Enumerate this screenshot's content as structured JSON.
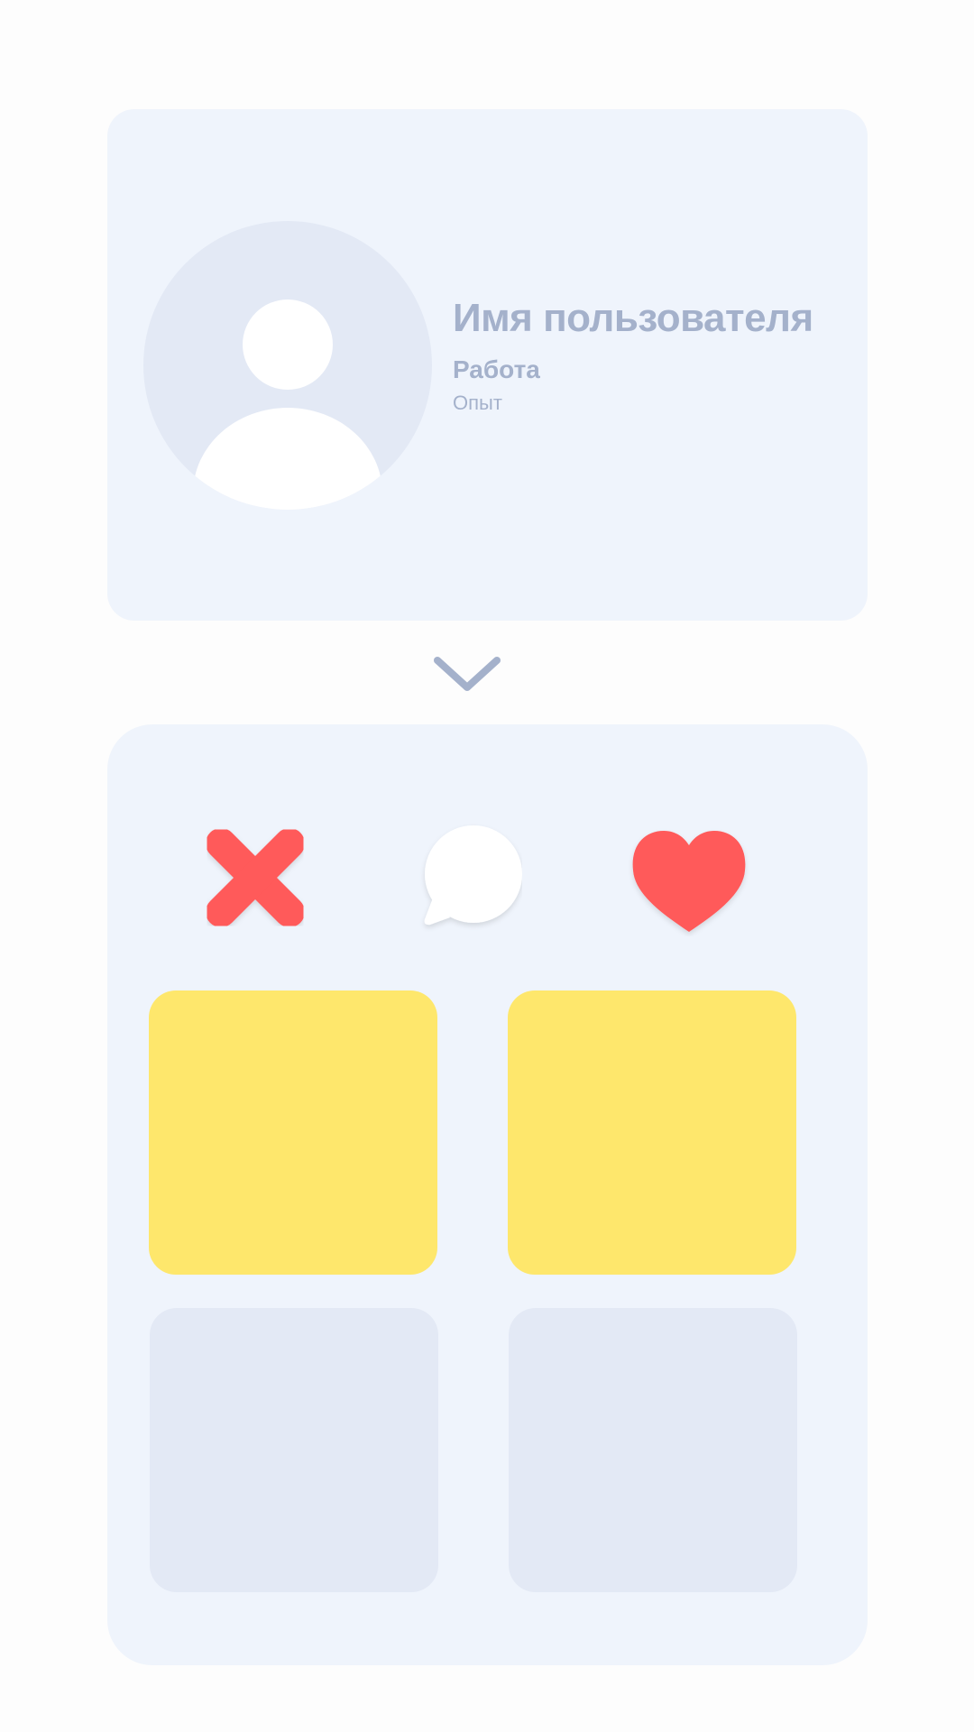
{
  "profile": {
    "name": "Имя пользователя",
    "job": "Работа",
    "experience": "Опыт",
    "avatar_icon": "user-silhouette-icon"
  },
  "colors": {
    "page_background": "#fdfdfd",
    "card_background": "#eff4fc",
    "avatar_background": "#e3e9f5",
    "text": "#a4b1cb",
    "accent_red": "#ff5a5a",
    "tile_yellow": "#fee76c",
    "tile_gray": "#e3e9f5"
  },
  "expand": {
    "icon": "chevron-down-icon"
  },
  "actions": [
    {
      "name": "reject",
      "icon": "close-icon"
    },
    {
      "name": "message",
      "icon": "speech-bubble-icon"
    },
    {
      "name": "like",
      "icon": "heart-icon"
    }
  ],
  "tiles": [
    {
      "state": "highlighted"
    },
    {
      "state": "highlighted"
    },
    {
      "state": "empty"
    },
    {
      "state": "empty"
    }
  ]
}
